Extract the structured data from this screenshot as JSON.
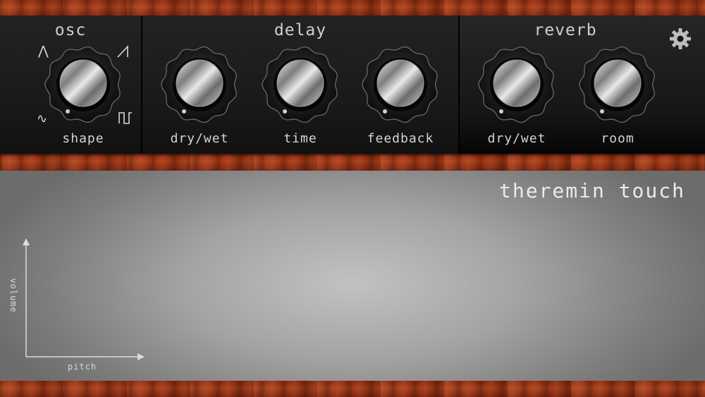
{
  "sections": {
    "osc": {
      "title": "osc",
      "knobs": [
        {
          "label": "shape"
        }
      ],
      "wave_icons": [
        "triangle-wave-icon",
        "sawtooth-wave-icon",
        "sine-wave-icon",
        "square-wave-icon"
      ]
    },
    "delay": {
      "title": "delay",
      "knobs": [
        {
          "label": "dry/wet"
        },
        {
          "label": "time"
        },
        {
          "label": "feedback"
        }
      ]
    },
    "reverb": {
      "title": "reverb",
      "knobs": [
        {
          "label": "dry/wet"
        },
        {
          "label": "room"
        }
      ]
    }
  },
  "settings_icon": "gear-icon",
  "touch_area": {
    "title": "theremin touch",
    "x_axis_label": "pitch",
    "y_axis_label": "volume"
  },
  "colors": {
    "wood": "#a8401c",
    "panel": "#1a1a1a",
    "label": "#d4d4d4"
  }
}
